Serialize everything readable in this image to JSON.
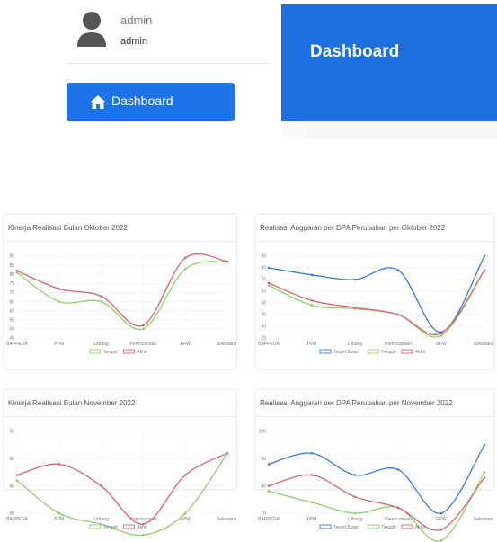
{
  "user": {
    "name": "admin",
    "role": "admin"
  },
  "nav": {
    "dashboard_label": "Dashboard"
  },
  "header": {
    "title": "Dashboard"
  },
  "colors": {
    "accent": "#1d73e8",
    "target": "#3a7be0",
    "tengah": "#8fcf6b",
    "akhir": "#d9646b"
  },
  "cards": [
    {
      "title": "Kinerja Realisasi Bulan Oktober 2022"
    },
    {
      "title": "Realisasi Anggaran per DPA Perubahan per Oktober 2022"
    },
    {
      "title": "Kinerja Realisasi Bulan November 2022"
    },
    {
      "title": "Realisasi Anggaran per DPA Perubahan per November 2022"
    }
  ],
  "chart_data": [
    {
      "type": "line",
      "title": "Kinerja Realisasi Bulan Oktober 2022",
      "categories": [
        "BAPPEDA",
        "PPM",
        "Litbang",
        "Perencanaan",
        "EPW",
        "Sekretariat"
      ],
      "ylim": [
        45,
        90
      ],
      "yticks": [
        45,
        50,
        55,
        60,
        65,
        70,
        75,
        80,
        85,
        90
      ],
      "series": [
        {
          "name": "Tengah",
          "color": "#8fcf6b",
          "values": [
            81,
            65,
            65,
            50,
            83,
            87
          ]
        },
        {
          "name": "Akhir",
          "color": "#d9646b",
          "values": [
            82,
            72,
            68,
            52,
            89,
            87
          ]
        }
      ]
    },
    {
      "type": "line",
      "title": "Realisasi Anggaran per DPA Perubahan per Oktober 2022",
      "categories": [
        "BAPPEDA",
        "PPM",
        "Litbang",
        "Perencanaan",
        "EPW",
        "Sekretariat"
      ],
      "ylim": [
        20,
        90
      ],
      "yticks": [
        20,
        30,
        40,
        50,
        60,
        70,
        80,
        90
      ],
      "series": [
        {
          "name": "Target Bulan",
          "color": "#3a7be0",
          "values": [
            80,
            74,
            70,
            78,
            25,
            90
          ]
        },
        {
          "name": "Tengah",
          "color": "#8fcf6b",
          "values": [
            65,
            48,
            45,
            40,
            22,
            78
          ]
        },
        {
          "name": "Akhir",
          "color": "#d9646b",
          "values": [
            67,
            52,
            46,
            40,
            24,
            78
          ]
        }
      ]
    },
    {
      "type": "line",
      "title": "Kinerja Realisasi Bulan November 2022",
      "categories": [
        "BAPPEDA",
        "PPM",
        "Litbang",
        "Perencanaan",
        "EPW",
        "Sekretariat"
      ],
      "ylim": [
        80,
        95
      ],
      "yticks": [
        80,
        85,
        90,
        95
      ],
      "series": [
        {
          "name": "Tengah",
          "color": "#8fcf6b",
          "values": [
            86,
            80,
            78,
            76,
            80,
            91
          ]
        },
        {
          "name": "Akhir",
          "color": "#d9646b",
          "values": [
            87,
            89,
            85,
            78,
            87,
            91
          ]
        }
      ]
    },
    {
      "type": "line",
      "title": "Realisasi Anggaran per DPA Perubahan per November 2022",
      "categories": [
        "BAPPEDA",
        "PPM",
        "Litbang",
        "Perencanaan",
        "EPW",
        "Sekretariat"
      ],
      "ylim": [
        70,
        100
      ],
      "yticks": [
        70,
        80,
        90,
        100
      ],
      "series": [
        {
          "name": "Target Bulan",
          "color": "#3a7be0",
          "values": [
            88,
            92,
            84,
            86,
            70,
            95
          ]
        },
        {
          "name": "Tengah",
          "color": "#8fcf6b",
          "values": [
            78,
            74,
            70,
            72,
            60,
            85
          ]
        },
        {
          "name": "Akhir",
          "color": "#d9646b",
          "values": [
            80,
            84,
            76,
            72,
            64,
            83
          ]
        }
      ]
    }
  ]
}
